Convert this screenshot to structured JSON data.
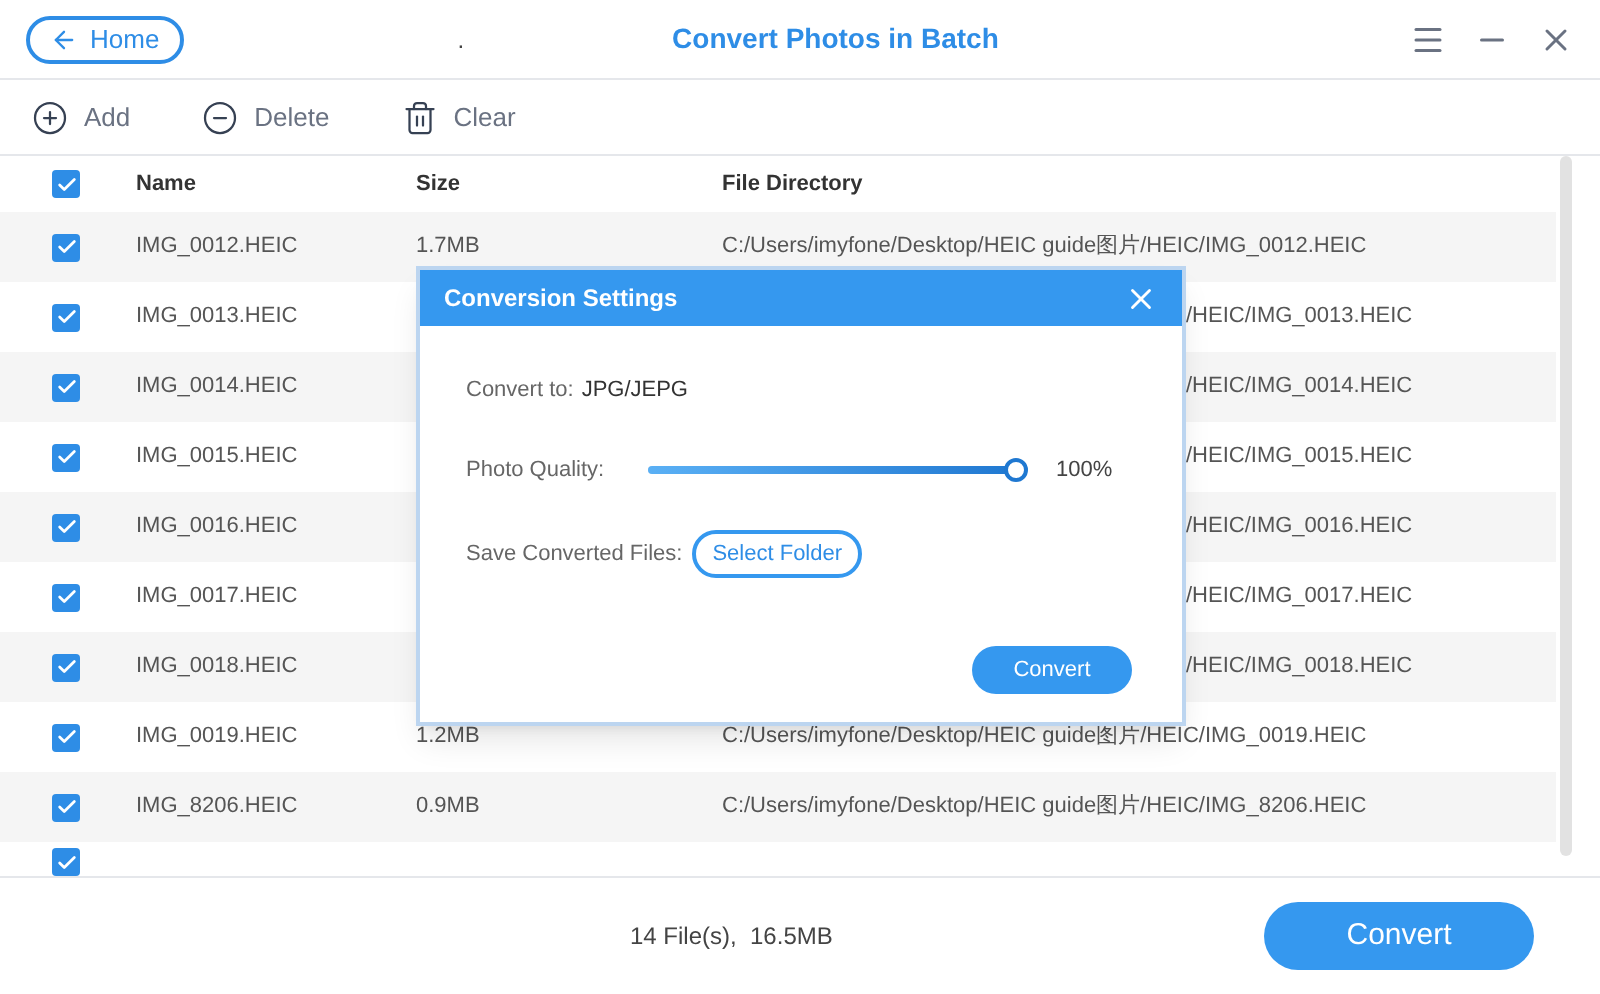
{
  "header": {
    "home_button": "Home",
    "dot_mark": ".",
    "title": "Convert Photos in Batch"
  },
  "toolbar": [
    {
      "kind": "add",
      "label": "Add"
    },
    {
      "kind": "delete",
      "label": "Delete"
    },
    {
      "kind": "clear",
      "label": "Clear"
    }
  ],
  "table": {
    "select_all": {
      "checked": true
    },
    "columns": [
      "Name",
      "Size",
      "File Directory"
    ],
    "rows": [
      {
        "checked": true,
        "name": "IMG_0012.HEIC",
        "size": "1.7MB",
        "directory": "C:/Users/imyfone/Desktop/HEIC guide图片/HEIC/IMG_0012.HEIC"
      },
      {
        "checked": true,
        "name": "IMG_0013.HEIC",
        "directory": "/HEIC/IMG_0013.HEIC"
      },
      {
        "checked": true,
        "name": "IMG_0014.HEIC",
        "directory": "/HEIC/IMG_0014.HEIC"
      },
      {
        "checked": true,
        "name": "IMG_0015.HEIC",
        "directory": "/HEIC/IMG_0015.HEIC"
      },
      {
        "checked": true,
        "name": "IMG_0016.HEIC",
        "directory": "/HEIC/IMG_0016.HEIC"
      },
      {
        "checked": true,
        "name": "IMG_0017.HEIC",
        "directory": "/HEIC/IMG_0017.HEIC"
      },
      {
        "checked": true,
        "name": "IMG_0018.HEIC",
        "directory": "/HEIC/IMG_0018.HEIC"
      },
      {
        "checked": true,
        "name": "IMG_0019.HEIC",
        "size": "1.2MB",
        "directory": "C:/Users/imyfone/Desktop/HEIC guide图片/HEIC/IMG_0019.HEIC"
      },
      {
        "checked": true,
        "name": "IMG_8206.HEIC",
        "size": "0.9MB",
        "directory": "C:/Users/imyfone/Desktop/HEIC guide图片/HEIC/IMG_8206.HEIC"
      },
      {
        "checked": true
      }
    ]
  },
  "footer": {
    "summary": "14 File(s),  16.5MB",
    "convert_button": "Convert"
  },
  "dialog": {
    "title": "Conversion Settings",
    "convert_to_label": "Convert to:",
    "convert_to_value": "JPG/JEPG",
    "quality_label": "Photo Quality:",
    "quality": {
      "level": 1
    },
    "quality_reading": "100%",
    "save_label": "Save Converted Files:",
    "select_folder_button": "Select Folder",
    "convert_button": "Convert"
  }
}
